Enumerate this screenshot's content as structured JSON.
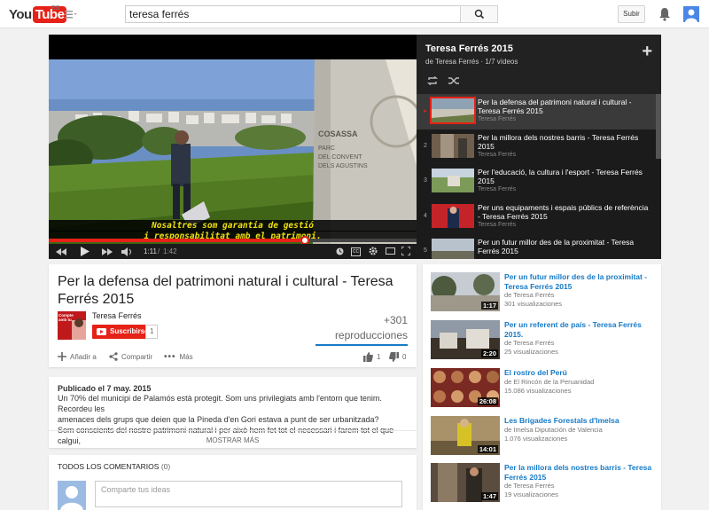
{
  "masthead": {
    "logo_you": "You",
    "logo_tube": "Tube",
    "logo_country": "ES",
    "search_value": "teresa ferrés",
    "upload_label": "Subir"
  },
  "player": {
    "subtitle_line1": "Nosaltres som garantia de gestió",
    "subtitle_line2": "i responsabilitat amb el patrimoni.",
    "sign_text_1": "COSASSA",
    "sign_text_2": "PARC",
    "sign_text_3": "DEL CONVENT",
    "sign_text_4": "DELS AGUSTINS",
    "time_current": "1:11",
    "time_total": "1:42",
    "progress_fraction": 0.696
  },
  "playlist": {
    "title": "Teresa Ferrés 2015",
    "subtitle": "de Teresa Ferrés · 1/7 vídeos",
    "items": [
      {
        "index": "▸",
        "title": "Per la defensa del patrimoni natural i cultural - Teresa Ferrés 2015",
        "channel": "Teresa Ferrés"
      },
      {
        "index": "2",
        "title": "Per la millora dels nostres barris - Teresa Ferrés 2015",
        "channel": "Teresa Ferrés"
      },
      {
        "index": "3",
        "title": "Per l'educació, la cultura i l'esport - Teresa Ferrés 2015",
        "channel": "Teresa Ferrés"
      },
      {
        "index": "4",
        "title": "Per uns equipaments i espais públics de referència - Teresa Ferrés 2015",
        "channel": "Teresa Ferrés"
      },
      {
        "index": "5",
        "title": "Per un futur millor des de la proximitat - Teresa Ferrés 2015",
        "channel": ""
      }
    ]
  },
  "video": {
    "title": "Per la defensa del patrimoni natural i cultural - Teresa Ferrés 2015",
    "owner": "Teresa Ferrés",
    "owner_thumb_text": "Compte amb tu",
    "subscribe_label": "Suscribirse",
    "sub_count": "1",
    "views_count": "+301",
    "views_label": "reproducciones",
    "add_label": "Añadir a",
    "share_label": "Compartir",
    "more_label": "Más",
    "likes": "1",
    "dislikes": "0"
  },
  "description": {
    "published": "Publicado el 7 may. 2015",
    "line1": "Un 70% del municipi de Palamós està protegit. Som uns privilegiats amb l'entorn que tenim. Recordeu les",
    "line2": "amenaces dels grups que deien que la Pineda d'en Gori estava a punt de ser urbanitzada?",
    "line3": "Som conscients del nostre patrimoni natural i per això hem fet tot el necessari i farem tot el que calgui,",
    "show_more": "MOSTRAR MÁS"
  },
  "comments": {
    "header": "TODOS LOS COMENTARIOS",
    "count": "(0)",
    "placeholder": "Comparte tus ideas"
  },
  "related": [
    {
      "title": "Per un futur millor des de la proximitat - Teresa Ferrés 2015",
      "channel": "de Teresa Ferrés",
      "views": "301 visualizaciones",
      "duration": "1:17"
    },
    {
      "title": "Per un referent de país - Teresa Ferrés 2015.",
      "channel": "de Teresa Ferrés",
      "views": "25 visualizaciones",
      "duration": "2:20"
    },
    {
      "title": "El rostro del Perú",
      "channel": "de El Rincón de la Peruanidad",
      "views": "15.086 visualizaciones",
      "duration": "26:08"
    },
    {
      "title": "Les Brigades Forestals d'Imelsa",
      "channel": "de Imelsa Diputación de Valencia",
      "views": "1.076 visualizaciones",
      "duration": "14:01"
    },
    {
      "title": "Per la millora dels nostres barris - Teresa Ferrés 2015",
      "channel": "de Teresa Ferrés",
      "views": "19 visualizaciones",
      "duration": "1:47"
    }
  ],
  "colors": {
    "brand_red": "#e62117",
    "link_blue": "#167ac6",
    "subtitle_yellow": "#f0e010"
  }
}
